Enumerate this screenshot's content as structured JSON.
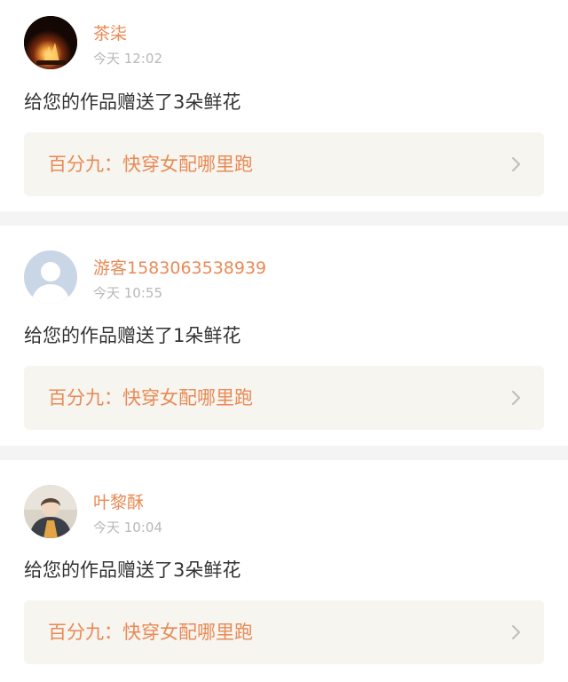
{
  "notifications": [
    {
      "username": "茶柒",
      "time": "今天 12:02",
      "message": "给您的作品赠送了3朵鲜花",
      "work_title": "百分九：快穿女配哪里跑",
      "avatar": "campfire-photo-avatar"
    },
    {
      "username": "游客1583063538939",
      "time": "今天 10:55",
      "message": "给您的作品赠送了1朵鲜花",
      "work_title": "百分九：快穿女配哪里跑",
      "avatar": "default-user-avatar"
    },
    {
      "username": "叶黎酥",
      "time": "今天 10:04",
      "message": "给您的作品赠送了3朵鲜花",
      "work_title": "百分九：快穿女配哪里跑",
      "avatar": "person-photo-avatar"
    }
  ],
  "icons": {
    "chevron": "chevron-right-icon"
  },
  "colors": {
    "accent": "#e98a55",
    "timestamp": "#b8b8b8",
    "link_background": "#f6f5f0",
    "separator": "#f4f4f4"
  }
}
